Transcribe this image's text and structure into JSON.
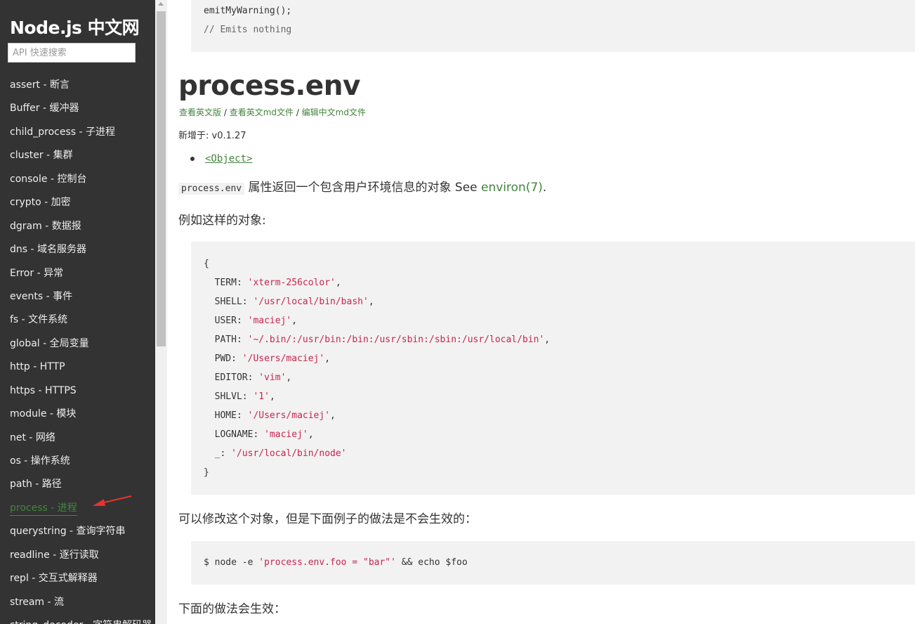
{
  "sidebar": {
    "title": "Node.js 中文网",
    "search_placeholder": "API 快速搜索",
    "items": [
      {
        "label": "assert - 断言"
      },
      {
        "label": "Buffer - 缓冲器"
      },
      {
        "label": "child_process - 子进程"
      },
      {
        "label": "cluster - 集群"
      },
      {
        "label": "console - 控制台"
      },
      {
        "label": "crypto - 加密"
      },
      {
        "label": "dgram - 数据报"
      },
      {
        "label": "dns - 域名服务器"
      },
      {
        "label": "Error - 异常"
      },
      {
        "label": "events - 事件"
      },
      {
        "label": "fs - 文件系统"
      },
      {
        "label": "global - 全局变量"
      },
      {
        "label": "http - HTTP"
      },
      {
        "label": "https - HTTPS"
      },
      {
        "label": "module - 模块"
      },
      {
        "label": "net - 网络"
      },
      {
        "label": "os - 操作系统"
      },
      {
        "label": "path - 路径"
      },
      {
        "label": "process - 进程",
        "active": true
      },
      {
        "label": "querystring - 查询字符串"
      },
      {
        "label": "readline - 逐行读取"
      },
      {
        "label": "repl - 交互式解释器"
      },
      {
        "label": "stream - 流"
      },
      {
        "label": "string_decoder - 字符串解码器"
      }
    ],
    "active_color": "#43853d",
    "arrow_color": "#e8322f"
  },
  "content": {
    "top_code": {
      "line1": "emitMyWarning();",
      "line2": "// Emits nothing"
    },
    "heading": "process.env",
    "links": {
      "view_en": "查看英文版",
      "sep1": " / ",
      "view_en_md": "查看英文md文件",
      "sep2": " / ",
      "edit_cn_md": "编辑中文md文件"
    },
    "added_in": "新增于: v0.1.27",
    "type": "<Object>",
    "desc": {
      "code": "process.env",
      "text": " 属性返回一个包含用户环境信息的对象 See ",
      "link": "environ(7)",
      "end": "."
    },
    "example_intro": "例如这样的对象:",
    "env_block": {
      "open": "{",
      "entries": [
        {
          "key": "TERM",
          "value": "'xterm-256color'"
        },
        {
          "key": "SHELL",
          "value": "'/usr/local/bin/bash'"
        },
        {
          "key": "USER",
          "value": "'maciej'"
        },
        {
          "key": "PATH",
          "value": "'~/.bin/:/usr/bin:/bin:/usr/sbin:/sbin:/usr/local/bin'"
        },
        {
          "key": "PWD",
          "value": "'/Users/maciej'"
        },
        {
          "key": "EDITOR",
          "value": "'vim'"
        },
        {
          "key": "SHLVL",
          "value": "'1'"
        },
        {
          "key": "HOME",
          "value": "'/Users/maciej'"
        },
        {
          "key": "LOGNAME",
          "value": "'maciej'"
        },
        {
          "key": "_",
          "value": "'/usr/local/bin/node'",
          "last": true
        }
      ],
      "close": "}"
    },
    "modify_text": "可以修改这个对象，但是下面例子的做法是不会生效的：",
    "shell_cmd": {
      "prefix": "$ node -e ",
      "string": "'process.env.foo = \"bar\"'",
      "suffix": " && echo $foo"
    },
    "works_text": "下面的做法会生效："
  },
  "colors": {
    "sidebar_bg": "#333333",
    "link_green": "#43853d",
    "code_string": "#c7254e",
    "code_bg": "#f2f2f2"
  }
}
